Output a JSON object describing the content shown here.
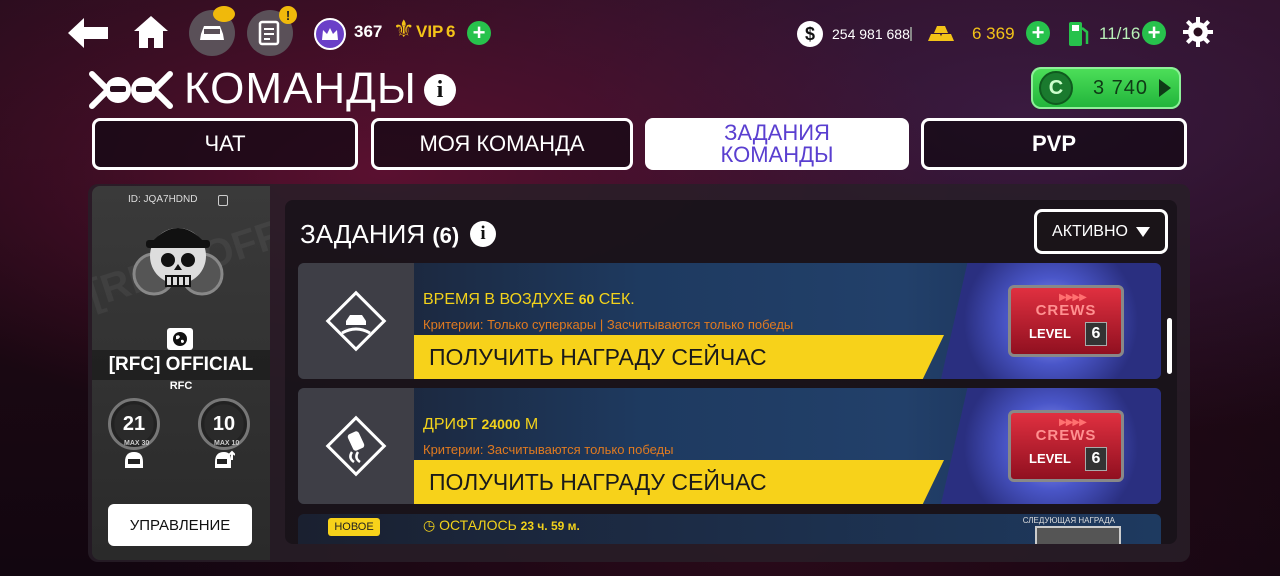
{
  "topbar": {
    "level_value": "367",
    "vip_label": "VIP",
    "vip_value": "6",
    "cash_symbol": "$",
    "cash_value": "254 981 688",
    "gold_value": "6 369",
    "fuel_value": "11/16",
    "plus_symbol": "+",
    "alert_mark": "!"
  },
  "title": {
    "text": "КОМАНДЫ",
    "info_mark": "i"
  },
  "currency_button": {
    "symbol": "C",
    "value": "3 740"
  },
  "tabs": [
    {
      "label": "ЧАТ",
      "active": false
    },
    {
      "label": "МОЯ КОМАНДА",
      "active": false
    },
    {
      "label": "ЗАДАНИЯ КОМАНДЫ",
      "line1": "ЗАДАНИЯ",
      "line2": "КОМАНДЫ",
      "active": true
    },
    {
      "label": "PVP",
      "active": false
    }
  ],
  "crew_card": {
    "id": "ID: JQA7HDND",
    "background_text": "[RFC] OFFICIAL",
    "name": "[RFC] OFFICIAL",
    "tag": "RFC",
    "members_value": "21",
    "members_max": "MAX 30",
    "officers_value": "10",
    "officers_max": "MAX 10",
    "manage_label": "УПРАВЛЕНИЕ"
  },
  "tasks_panel": {
    "title": "ЗАДАНИЯ",
    "count": "(6)",
    "info_mark": "i",
    "filter_label": "АКТИВНО"
  },
  "tasks": [
    {
      "title": "ВРЕМЯ В ВОЗДУХЕ",
      "amount": "60",
      "unit": "СЕК.",
      "criteria": "Критерии: Только суперкары | Засчитываются только победы",
      "claim_label": "ПОЛУЧИТЬ НАГРАДУ СЕЙЧАС",
      "reward_brand": "CREWS",
      "reward_level_label": "LEVEL",
      "reward_level": "6",
      "icon": "airtime-car-icon"
    },
    {
      "title": "ДРИФТ",
      "amount": "24000",
      "unit": "М",
      "criteria": "Критерии: Засчитываются только победы",
      "claim_label": "ПОЛУЧИТЬ НАГРАДУ СЕЙЧАС",
      "reward_brand": "CREWS",
      "reward_level_label": "LEVEL",
      "reward_level": "6",
      "icon": "drift-car-icon"
    }
  ],
  "next_task": {
    "badge": "НОВОЕ",
    "timer_label": "ОСТАЛОСЬ",
    "timer_value": "23 ч. 59 м.",
    "next_reward_label": "СЛЕДУЮЩАЯ НАГРАДА"
  },
  "colors": {
    "accent_yellow": "#f7d21a",
    "tab_active_text": "#5a3fd0",
    "green_button": "#27c24c",
    "criteria_orange": "#e07a20"
  }
}
